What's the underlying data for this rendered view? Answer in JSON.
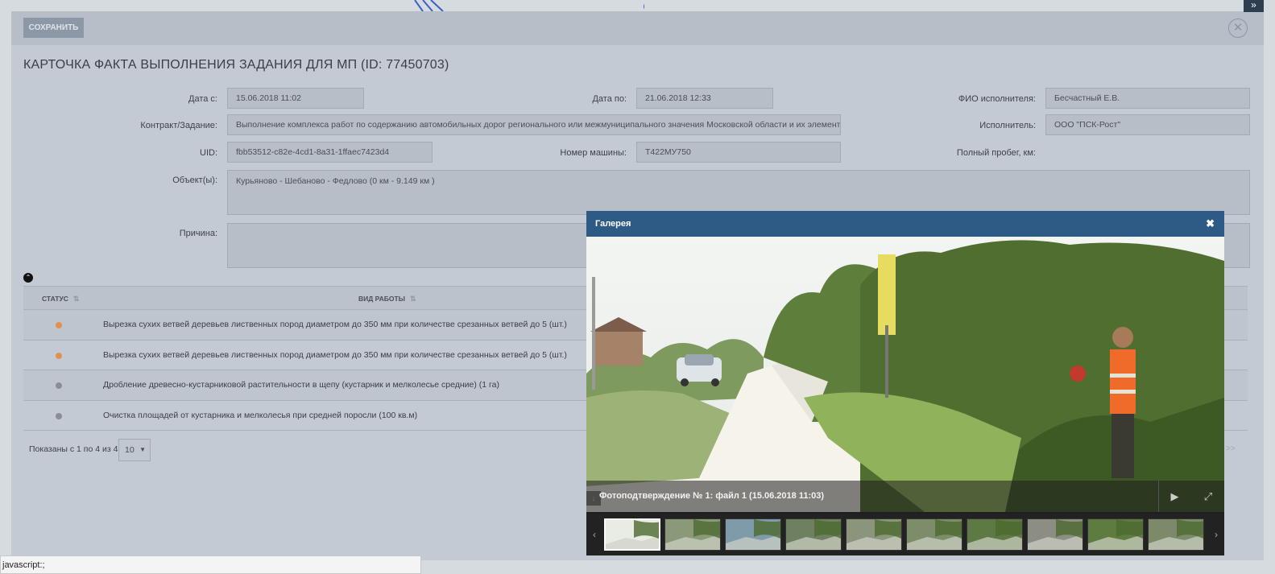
{
  "toolbar": {
    "save_label": "СОХРАНИТЬ",
    "close_glyph": "✕",
    "expand_glyph": "»"
  },
  "card": {
    "title": "КАРТОЧКА ФАКТА ВЫПОЛНЕНИЯ ЗАДАНИЯ ДЛЯ МП (ID: 77450703)"
  },
  "form": {
    "date_from": {
      "label": "Дата с:",
      "value": "15.06.2018 11:02"
    },
    "date_to": {
      "label": "Дата по:",
      "value": "21.06.2018 12:33"
    },
    "executor_name": {
      "label": "ФИО исполнителя:",
      "value": "Бесчастный Е.В."
    },
    "contract": {
      "label": "Контракт/Задание:",
      "value": "Выполнение комплекса работ по содержанию автомобильных дорог регионального или межмуниципального значения Московской области и их элементов в Волоколамском"
    },
    "executor": {
      "label": "Исполнитель:",
      "value": "ООО \"ПСК-Рост\""
    },
    "uid": {
      "label": "UID:",
      "value": "fbb53512-c82e-4cd1-8a31-1ffaec7423d4"
    },
    "car_number": {
      "label": "Номер машины:",
      "value": "Т422МУ750"
    },
    "mileage": {
      "label": "Полный пробег, км:"
    },
    "objects": {
      "label": "Объект(ы):",
      "value": "Курьяново - Шебаново - Федлово (0 км - 9.149 км )"
    },
    "reason": {
      "label": "Причина:",
      "value": ""
    }
  },
  "table": {
    "headers": {
      "status": "СТАТУС",
      "work_type": "ВИД РАБОТЫ"
    },
    "rows": [
      {
        "status_color": "#e2904f",
        "text": "Вырезка сухих ветвей деревьев лиственных пород диаметром до 350 мм при количестве срезанных ветвей до 5 (шт.)"
      },
      {
        "status_color": "#e2904f",
        "text": "Вырезка сухих ветвей деревьев лиственных пород диаметром до 350 мм при количестве срезанных ветвей до 5 (шт.)"
      },
      {
        "status_color": "#8a8f96",
        "text": "Дробление древесно-кустарниковой растительности в щепу (кустарник и мелколесье средние) (1 га)"
      },
      {
        "status_color": "#8a8f96",
        "text": "Очистка площадей от кустарника и мелколесья при средней поросли (100 кв.м)"
      }
    ]
  },
  "pager": {
    "info": "Показаны с 1 по 4 из 4",
    "page_size": "10",
    "next": ">>"
  },
  "gallery": {
    "title": "Галерея",
    "close_glyph": "✖",
    "caption": "Фотоподтверждение № 1: файл 1 (15.06.2018 11:03)",
    "play_glyph": "▶",
    "fullscreen_glyph": "⤢",
    "download_glyph": "↓",
    "prev_glyph": "‹",
    "next_glyph": "›",
    "thumbnail_count": 10
  },
  "statusbar": {
    "text": "javascript:;"
  }
}
